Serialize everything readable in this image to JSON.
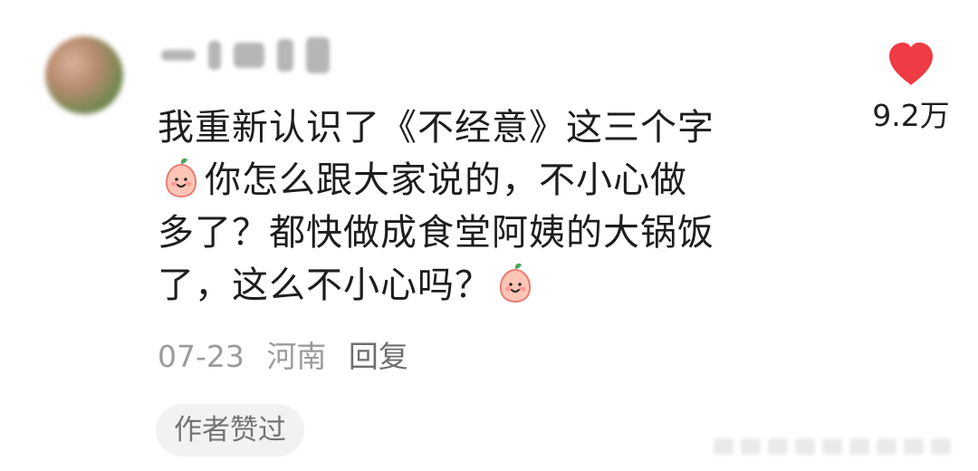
{
  "comment": {
    "lines": [
      {
        "parts": [
          {
            "type": "text",
            "text": "我重新认识了《不经意》这三个字"
          }
        ]
      },
      {
        "parts": [
          {
            "type": "emoji",
            "name": "peach-smile-emoji"
          },
          {
            "type": "text",
            "text": "你怎么跟大家说的，不小心做"
          }
        ]
      },
      {
        "parts": [
          {
            "type": "text",
            "text": "多了？都快做成食堂阿姨的大锅饭"
          }
        ]
      },
      {
        "parts": [
          {
            "type": "text",
            "text": "了，这么不小心吗？"
          },
          {
            "type": "emoji",
            "name": "peach-smile-emoji"
          }
        ]
      }
    ]
  },
  "meta": {
    "date": "07-23",
    "location": "河南",
    "reply": "回复"
  },
  "like": {
    "count": "9.2万",
    "icon": "heart-icon",
    "color": "#ef3b43"
  },
  "badge": {
    "author_liked": "作者赞过"
  },
  "emoji": {
    "name": "peach-smile-emoji",
    "colors": {
      "body": "#ffc5b7",
      "outline": "#e97d72",
      "leaf": "#4aa65b",
      "blush": "#ff9b95",
      "face": "#2f2523"
    }
  }
}
